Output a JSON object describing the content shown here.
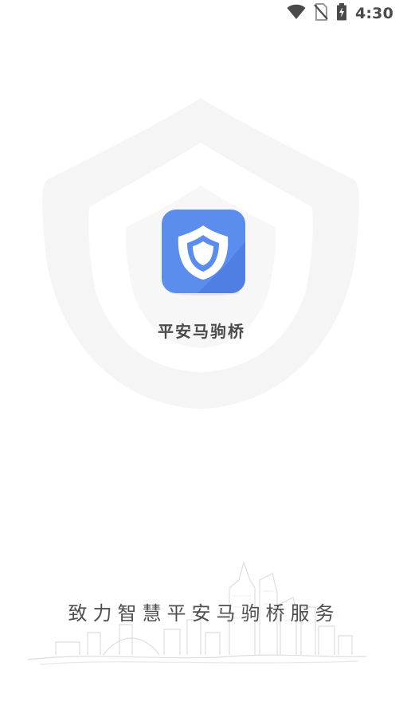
{
  "status_bar": {
    "time": "4:30",
    "icons": [
      "wifi-icon",
      "no-sim-icon",
      "battery-charging-icon"
    ]
  },
  "splash": {
    "app_name": "平安马驹桥",
    "slogan": "致力智慧平安马驹桥服务"
  },
  "colors": {
    "icon_blue": "#5b8def",
    "text": "#4a4a4a",
    "watermark": "#f4f4f4"
  }
}
